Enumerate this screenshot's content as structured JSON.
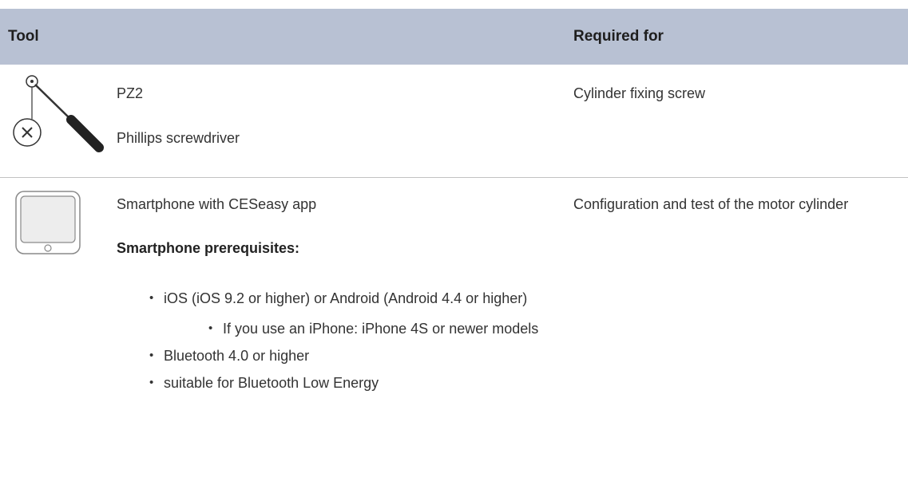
{
  "header": {
    "tool": "Tool",
    "required_for": "Required for"
  },
  "rows": [
    {
      "icon": "screwdriver-icon",
      "tool_name": "PZ2",
      "tool_desc": "Phillips screwdriver",
      "required_for": "Cylinder fixing screw"
    },
    {
      "icon": "smartphone-icon",
      "tool_name": "Smartphone with CESeasy app",
      "prereq_heading": "Smartphone prerequisites:",
      "prereqs": [
        "iOS (iOS 9.2 or higher) or Android (Android 4.4 or higher)",
        "Bluetooth 4.0 or higher",
        "suitable for Bluetooth Low Energy"
      ],
      "sub_prereqs": [
        "If you use an iPhone: iPhone 4S or newer models"
      ],
      "required_for": "Configuration and test of the motor cylinder"
    }
  ],
  "colors": {
    "header_bg": "#b8c1d3",
    "divider": "#c2c2c2",
    "text": "#333333"
  }
}
